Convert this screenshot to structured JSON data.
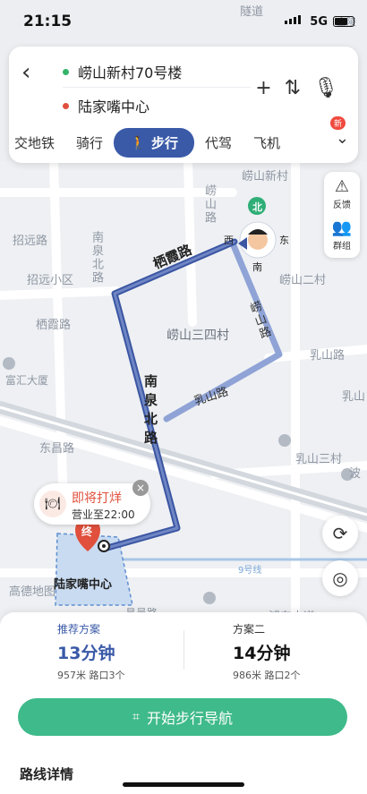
{
  "status_bar": {
    "time": "21:15",
    "network": "5G"
  },
  "route": {
    "from": "崂山新村70号楼",
    "to": "陆家嘴中心",
    "from_color": "#34b36a",
    "to_color": "#e0503c"
  },
  "modes": [
    {
      "label": "交地铁",
      "active": false
    },
    {
      "label": "骑行",
      "active": false
    },
    {
      "label": "步行",
      "active": true
    },
    {
      "label": "代驾",
      "active": false
    },
    {
      "label": "飞机",
      "active": false
    }
  ],
  "more_badge": "新",
  "side_tools": {
    "feedback": "反馈",
    "group": "群组"
  },
  "map_labels": {
    "qixia": "栖霞路",
    "qixia2": "栖霞路",
    "nanquan": "南泉北路",
    "nanquan2": "南泉北路",
    "rushan": "乳山路",
    "rushan2": "乳山路",
    "laoshan_road": "崂山路",
    "laoshan_road2": "崂山路",
    "laoshan_xincun": "崂山新村",
    "laoshan_ercun": "崂山二村",
    "laoshan_sansi": "崂山三四村",
    "zhaoyuan_road": "招远路",
    "zhaoyuan_xiaoqu": "招远小区",
    "fuhui": "富汇大厦",
    "dongchang": "东昌路",
    "rushan_sancun": "乳山三村",
    "rushan_partial": "乳山",
    "gaode": "高德地图",
    "pudong_dadao": "浦东大道",
    "destination": "陆家嘴中心",
    "line9": "9号线",
    "suidao": "隧道",
    "jinling": "金陵",
    "changyi": "昌邑路",
    "bo": "波",
    "zhong": "终",
    "compass": {
      "n": "北",
      "s": "南",
      "w": "西",
      "e": "东"
    }
  },
  "poi_tip": {
    "title": "即将打烊",
    "hours": "营业至22:00"
  },
  "plans": [
    {
      "label": "推荐方案",
      "duration": "13分钟",
      "meta": "957米  路口3个"
    },
    {
      "label": "方案二",
      "duration": "14分钟",
      "meta": "986米  路口2个"
    }
  ],
  "start_nav": "开始步行导航",
  "details_title": "路线详情",
  "colors": {
    "route_main": "#4a63a8",
    "route_alt": "#a9b8dc",
    "accent_green": "#3fba8a"
  }
}
